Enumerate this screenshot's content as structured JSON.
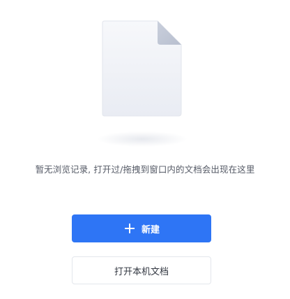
{
  "empty_state": {
    "message": "暂无浏览记录, 打开过/拖拽到窗口内的文档会出现在这里",
    "illustration_icon": "document-icon"
  },
  "actions": {
    "new_label": "新建",
    "new_icon": "plus-icon",
    "open_local_label": "打开本机文档"
  },
  "colors": {
    "primary": "#2e75f5",
    "text": "#555a66",
    "border": "#e3e6ec"
  }
}
